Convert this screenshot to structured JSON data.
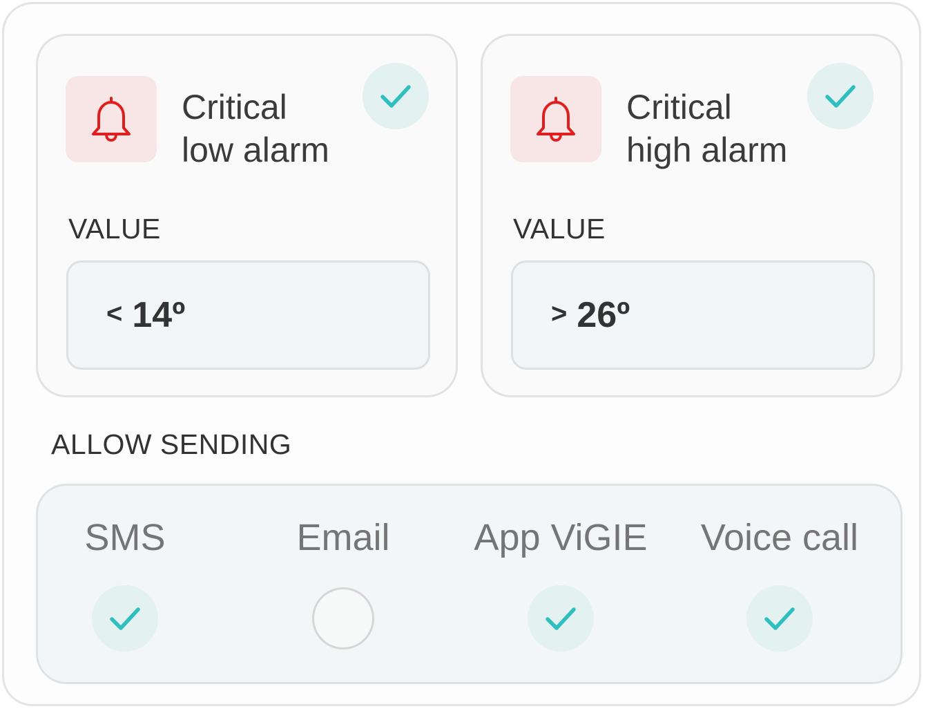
{
  "alarms": {
    "low": {
      "title_line1": "Critical",
      "title_line2": "low alarm",
      "value_label": "VALUE",
      "operator": "<",
      "value": "14º",
      "enabled": true
    },
    "high": {
      "title_line1": "Critical",
      "title_line2": "high alarm",
      "value_label": "VALUE",
      "operator": ">",
      "value": "26º",
      "enabled": true
    }
  },
  "allow_sending": {
    "label": "ALLOW SENDING",
    "channels": [
      {
        "label": "SMS",
        "checked": true
      },
      {
        "label": "Email",
        "checked": false
      },
      {
        "label": "App ViGIE",
        "checked": true
      },
      {
        "label": "Voice call",
        "checked": true
      }
    ]
  },
  "colors": {
    "bell": "#e01e1e",
    "bell_bg": "#f8e6e6",
    "check": "#2fbfbf",
    "check_bg": "#e3f1f1"
  },
  "icons": {
    "bell": "bell-icon",
    "check": "check-icon"
  }
}
